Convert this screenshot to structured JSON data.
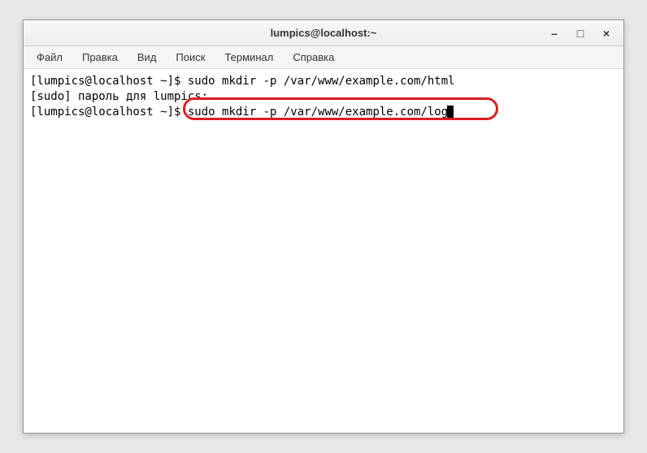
{
  "window": {
    "title": "lumpics@localhost:~"
  },
  "controls": {
    "minimize": "–",
    "maximize": "□",
    "close": "×"
  },
  "menu": {
    "file": "Файл",
    "edit": "Правка",
    "view": "Вид",
    "search": "Поиск",
    "terminal": "Терминал",
    "help": "Справка"
  },
  "terminal": {
    "line1_prompt": "[lumpics@localhost ~]$ ",
    "line1_cmd": "sudo mkdir -p /var/www/example.com/html",
    "line2": "[sudo] пароль для lumpics:",
    "line3_prompt": "[lumpics@localhost ~]$ ",
    "line3_cmd": "sudo mkdir -p /var/www/example.com/log"
  }
}
